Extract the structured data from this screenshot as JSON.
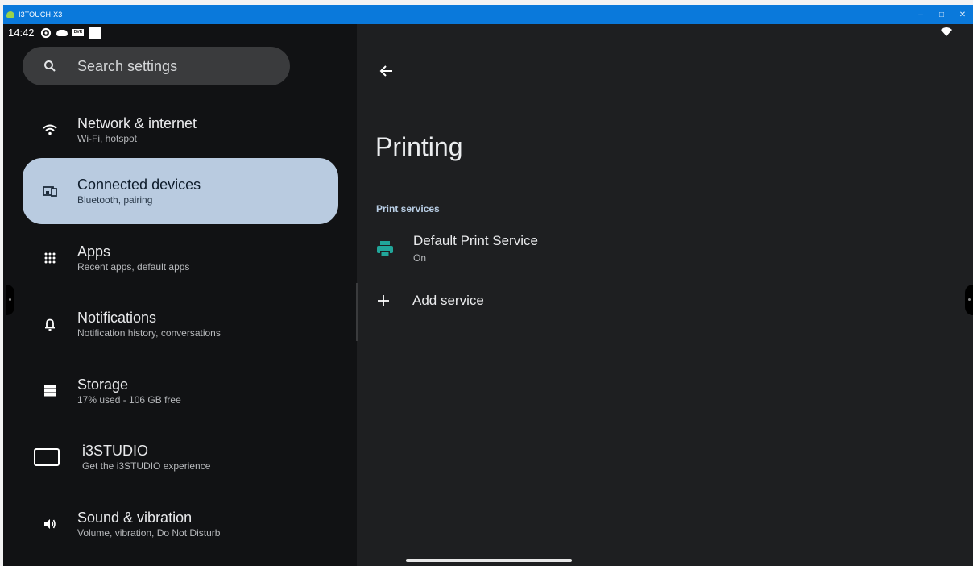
{
  "window": {
    "title": "I3TOUCH-X3",
    "controls": {
      "minimize": "–",
      "maximize": "□",
      "close": "✕"
    }
  },
  "status_bar": {
    "time": "14:42",
    "icons": [
      "settings-gear-icon",
      "cloud-icon",
      "dvr-icon",
      "square-icon"
    ],
    "dvr_text": "DVR",
    "right_icons": [
      "wifi-icon"
    ]
  },
  "sidebar": {
    "search_placeholder": "Search settings",
    "items": [
      {
        "label": "Network & internet",
        "sub": "Wi-Fi, hotspot",
        "icon": "wifi-icon"
      },
      {
        "label": "Connected devices",
        "sub": "Bluetooth, pairing",
        "icon": "devices-icon",
        "active": true
      },
      {
        "label": "Apps",
        "sub": "Recent apps, default apps",
        "icon": "apps-grid-icon"
      },
      {
        "label": "Notifications",
        "sub": "Notification history, conversations",
        "icon": "bell-icon"
      },
      {
        "label": "Storage",
        "sub": "17% used - 106 GB free",
        "icon": "storage-icon"
      },
      {
        "label": "i3STUDIO",
        "sub": "Get the i3STUDIO experience",
        "icon": "rectangle-icon"
      },
      {
        "label": "Sound & vibration",
        "sub": "Volume, vibration, Do Not Disturb",
        "icon": "speaker-icon"
      }
    ]
  },
  "main": {
    "title": "Printing",
    "section_header": "Print services",
    "services": [
      {
        "label": "Default Print Service",
        "status": "On",
        "icon": "printer-icon",
        "icon_color": "#21a69a"
      }
    ],
    "add_service_label": "Add service"
  },
  "colors": {
    "titlebar": "#0a79db",
    "active_item": "#b9cbe0",
    "accent_teal": "#21a69a",
    "section_header": "#b8cde4"
  }
}
